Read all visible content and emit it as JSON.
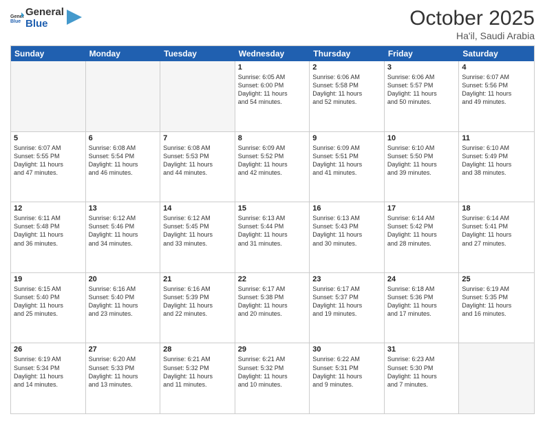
{
  "header": {
    "logo_general": "General",
    "logo_blue": "Blue",
    "month_title": "October 2025",
    "location": "Ha'il, Saudi Arabia"
  },
  "days_of_week": [
    "Sunday",
    "Monday",
    "Tuesday",
    "Wednesday",
    "Thursday",
    "Friday",
    "Saturday"
  ],
  "rows": [
    [
      {
        "day": "",
        "lines": [],
        "empty": true
      },
      {
        "day": "",
        "lines": [],
        "empty": true
      },
      {
        "day": "",
        "lines": [],
        "empty": true
      },
      {
        "day": "1",
        "lines": [
          "Sunrise: 6:05 AM",
          "Sunset: 6:00 PM",
          "Daylight: 11 hours",
          "and 54 minutes."
        ]
      },
      {
        "day": "2",
        "lines": [
          "Sunrise: 6:06 AM",
          "Sunset: 5:58 PM",
          "Daylight: 11 hours",
          "and 52 minutes."
        ]
      },
      {
        "day": "3",
        "lines": [
          "Sunrise: 6:06 AM",
          "Sunset: 5:57 PM",
          "Daylight: 11 hours",
          "and 50 minutes."
        ]
      },
      {
        "day": "4",
        "lines": [
          "Sunrise: 6:07 AM",
          "Sunset: 5:56 PM",
          "Daylight: 11 hours",
          "and 49 minutes."
        ]
      }
    ],
    [
      {
        "day": "5",
        "lines": [
          "Sunrise: 6:07 AM",
          "Sunset: 5:55 PM",
          "Daylight: 11 hours",
          "and 47 minutes."
        ]
      },
      {
        "day": "6",
        "lines": [
          "Sunrise: 6:08 AM",
          "Sunset: 5:54 PM",
          "Daylight: 11 hours",
          "and 46 minutes."
        ]
      },
      {
        "day": "7",
        "lines": [
          "Sunrise: 6:08 AM",
          "Sunset: 5:53 PM",
          "Daylight: 11 hours",
          "and 44 minutes."
        ]
      },
      {
        "day": "8",
        "lines": [
          "Sunrise: 6:09 AM",
          "Sunset: 5:52 PM",
          "Daylight: 11 hours",
          "and 42 minutes."
        ]
      },
      {
        "day": "9",
        "lines": [
          "Sunrise: 6:09 AM",
          "Sunset: 5:51 PM",
          "Daylight: 11 hours",
          "and 41 minutes."
        ]
      },
      {
        "day": "10",
        "lines": [
          "Sunrise: 6:10 AM",
          "Sunset: 5:50 PM",
          "Daylight: 11 hours",
          "and 39 minutes."
        ]
      },
      {
        "day": "11",
        "lines": [
          "Sunrise: 6:10 AM",
          "Sunset: 5:49 PM",
          "Daylight: 11 hours",
          "and 38 minutes."
        ]
      }
    ],
    [
      {
        "day": "12",
        "lines": [
          "Sunrise: 6:11 AM",
          "Sunset: 5:48 PM",
          "Daylight: 11 hours",
          "and 36 minutes."
        ]
      },
      {
        "day": "13",
        "lines": [
          "Sunrise: 6:12 AM",
          "Sunset: 5:46 PM",
          "Daylight: 11 hours",
          "and 34 minutes."
        ]
      },
      {
        "day": "14",
        "lines": [
          "Sunrise: 6:12 AM",
          "Sunset: 5:45 PM",
          "Daylight: 11 hours",
          "and 33 minutes."
        ]
      },
      {
        "day": "15",
        "lines": [
          "Sunrise: 6:13 AM",
          "Sunset: 5:44 PM",
          "Daylight: 11 hours",
          "and 31 minutes."
        ]
      },
      {
        "day": "16",
        "lines": [
          "Sunrise: 6:13 AM",
          "Sunset: 5:43 PM",
          "Daylight: 11 hours",
          "and 30 minutes."
        ]
      },
      {
        "day": "17",
        "lines": [
          "Sunrise: 6:14 AM",
          "Sunset: 5:42 PM",
          "Daylight: 11 hours",
          "and 28 minutes."
        ]
      },
      {
        "day": "18",
        "lines": [
          "Sunrise: 6:14 AM",
          "Sunset: 5:41 PM",
          "Daylight: 11 hours",
          "and 27 minutes."
        ]
      }
    ],
    [
      {
        "day": "19",
        "lines": [
          "Sunrise: 6:15 AM",
          "Sunset: 5:40 PM",
          "Daylight: 11 hours",
          "and 25 minutes."
        ]
      },
      {
        "day": "20",
        "lines": [
          "Sunrise: 6:16 AM",
          "Sunset: 5:40 PM",
          "Daylight: 11 hours",
          "and 23 minutes."
        ]
      },
      {
        "day": "21",
        "lines": [
          "Sunrise: 6:16 AM",
          "Sunset: 5:39 PM",
          "Daylight: 11 hours",
          "and 22 minutes."
        ]
      },
      {
        "day": "22",
        "lines": [
          "Sunrise: 6:17 AM",
          "Sunset: 5:38 PM",
          "Daylight: 11 hours",
          "and 20 minutes."
        ]
      },
      {
        "day": "23",
        "lines": [
          "Sunrise: 6:17 AM",
          "Sunset: 5:37 PM",
          "Daylight: 11 hours",
          "and 19 minutes."
        ]
      },
      {
        "day": "24",
        "lines": [
          "Sunrise: 6:18 AM",
          "Sunset: 5:36 PM",
          "Daylight: 11 hours",
          "and 17 minutes."
        ]
      },
      {
        "day": "25",
        "lines": [
          "Sunrise: 6:19 AM",
          "Sunset: 5:35 PM",
          "Daylight: 11 hours",
          "and 16 minutes."
        ]
      }
    ],
    [
      {
        "day": "26",
        "lines": [
          "Sunrise: 6:19 AM",
          "Sunset: 5:34 PM",
          "Daylight: 11 hours",
          "and 14 minutes."
        ]
      },
      {
        "day": "27",
        "lines": [
          "Sunrise: 6:20 AM",
          "Sunset: 5:33 PM",
          "Daylight: 11 hours",
          "and 13 minutes."
        ]
      },
      {
        "day": "28",
        "lines": [
          "Sunrise: 6:21 AM",
          "Sunset: 5:32 PM",
          "Daylight: 11 hours",
          "and 11 minutes."
        ]
      },
      {
        "day": "29",
        "lines": [
          "Sunrise: 6:21 AM",
          "Sunset: 5:32 PM",
          "Daylight: 11 hours",
          "and 10 minutes."
        ]
      },
      {
        "day": "30",
        "lines": [
          "Sunrise: 6:22 AM",
          "Sunset: 5:31 PM",
          "Daylight: 11 hours",
          "and 9 minutes."
        ]
      },
      {
        "day": "31",
        "lines": [
          "Sunrise: 6:23 AM",
          "Sunset: 5:30 PM",
          "Daylight: 11 hours",
          "and 7 minutes."
        ]
      },
      {
        "day": "",
        "lines": [],
        "empty": true
      }
    ]
  ]
}
